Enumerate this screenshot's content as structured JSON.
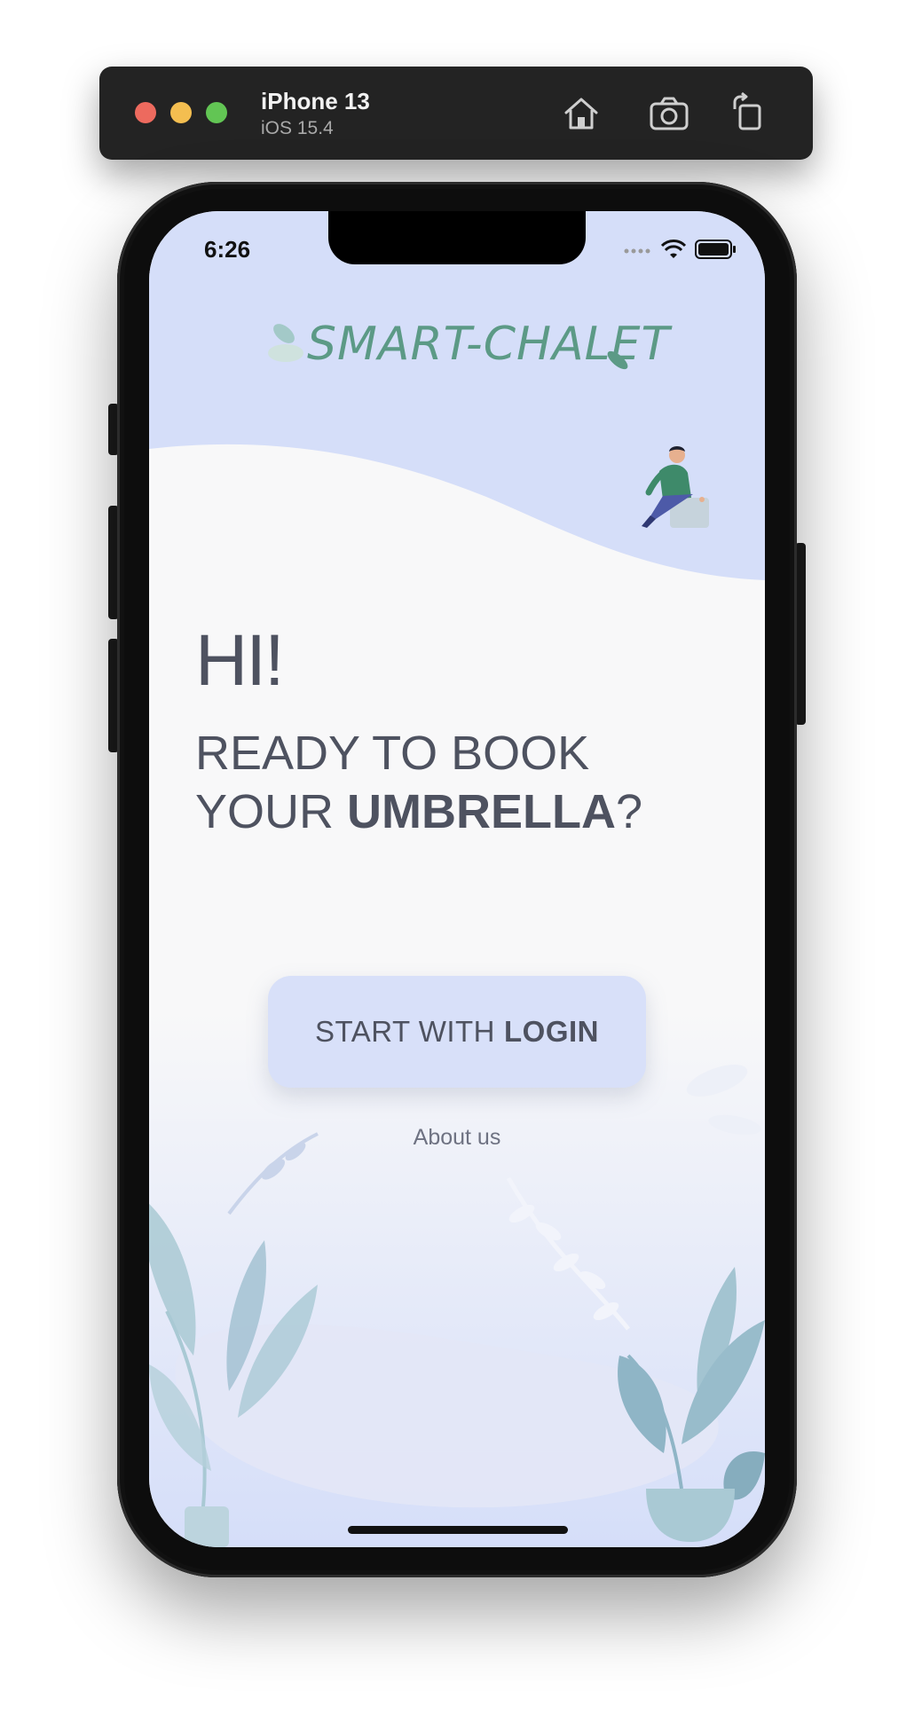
{
  "simulator": {
    "device_name": "iPhone 13",
    "os_version": "iOS 15.4",
    "icons": [
      "home-icon",
      "screenshot-icon",
      "rotate-icon"
    ]
  },
  "status_bar": {
    "time": "6:26",
    "icons": [
      "cellular-icon",
      "wifi-icon",
      "battery-icon"
    ]
  },
  "brand": {
    "logo_text": "SMART-CHALET",
    "logo_color": "#5c9a86"
  },
  "welcome": {
    "greeting": "HI!",
    "line1": "READY TO BOOK",
    "line2_prefix": "YOUR ",
    "line2_bold": "UMBRELLA",
    "line2_suffix": "?"
  },
  "actions": {
    "login_prefix": "START WITH",
    "login_bold": "LOGIN",
    "about_label": "About us"
  },
  "colors": {
    "accent_bg": "#d8e0f9",
    "text": "#4e5260",
    "plant": "#a9c9d4"
  }
}
